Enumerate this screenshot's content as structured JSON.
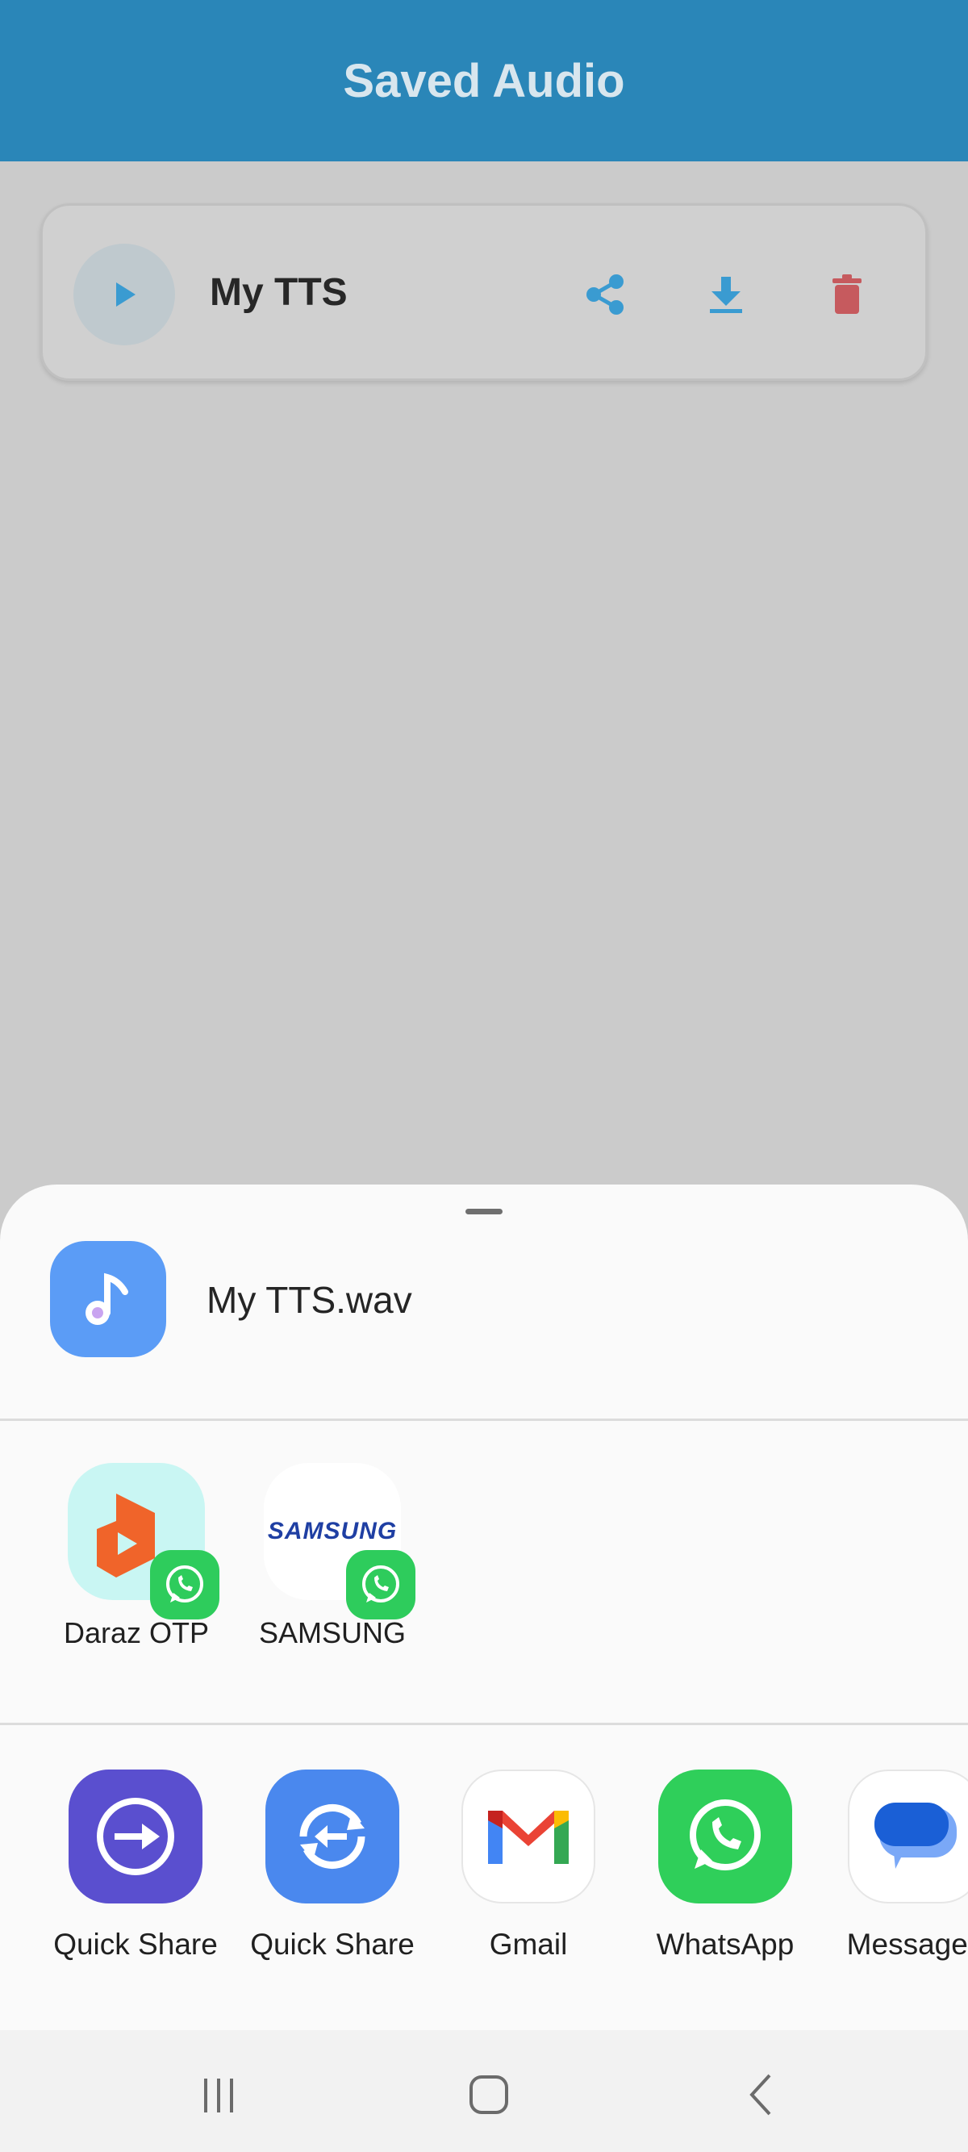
{
  "app_bar": {
    "title": "Saved Audio"
  },
  "saved_list": [
    {
      "name": "My TTS",
      "actions": {
        "share": "share-icon",
        "download": "download-icon",
        "delete": "trash-icon"
      }
    }
  ],
  "share_sheet": {
    "file_name": "My TTS.wav",
    "file_icon": "music-note-icon",
    "direct_share": [
      {
        "label": "Daraz OTP",
        "badge": "whatsapp-icon"
      },
      {
        "label": "SAMSUNG",
        "logo_text": "SAMSUNG",
        "badge": "whatsapp-icon"
      }
    ],
    "apps": [
      {
        "label": "Quick Share",
        "icon": "quick-share-icon"
      },
      {
        "label": "Quick Share",
        "icon": "quick-share-sync-icon"
      },
      {
        "label": "Gmail",
        "icon": "gmail-icon"
      },
      {
        "label": "WhatsApp",
        "icon": "whatsapp-icon"
      },
      {
        "label": "Messages",
        "icon": "messages-icon"
      }
    ]
  },
  "navigation": {
    "recents": "recents-icon",
    "home": "home-icon",
    "back": "back-icon"
  },
  "colors": {
    "app_bar": "#2a86b8",
    "accent": "#3a9bd1",
    "delete": "#c65a5e",
    "scrim_background": "#cbcbcb",
    "sheet": "#fafafa"
  }
}
